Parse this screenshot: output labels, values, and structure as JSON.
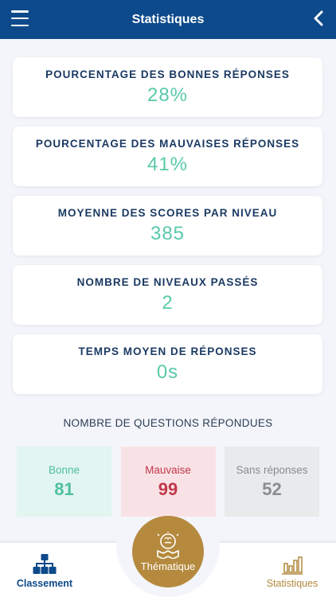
{
  "header": {
    "title": "Statistiques"
  },
  "stats": [
    {
      "label": "POURCENTAGE DES BONNES RÉPONSES",
      "value": "28%"
    },
    {
      "label": "POURCENTAGE DES MAUVAISES RÉPONSES",
      "value": "41%"
    },
    {
      "label": "MOYENNE DES SCORES PAR NIVEAU",
      "value": "385"
    },
    {
      "label": "NOMBRE DE NIVEAUX PASSÉS",
      "value": "2"
    },
    {
      "label": "TEMPS MOYEN DE RÉPONSES",
      "value": "0s"
    }
  ],
  "questions": {
    "heading": "NOMBRE DE QUESTIONS RÉPONDUES",
    "good": {
      "label": "Bonne",
      "value": "81"
    },
    "bad": {
      "label": "Mauvaise",
      "value": "99"
    },
    "none": {
      "label": "Sans réponses",
      "value": "52"
    }
  },
  "nav": {
    "left_label": "Classement",
    "center_label": "Thématique",
    "right_label": "Statistiques"
  },
  "colors": {
    "header": "#0d4a8b",
    "accent_green": "#5ac9a9",
    "accent_red": "#c1384a",
    "gold": "#b58a3f"
  }
}
